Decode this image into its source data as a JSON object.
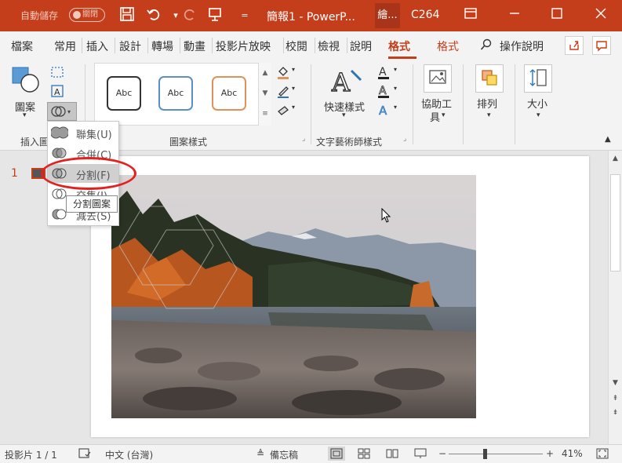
{
  "colors": {
    "accent": "#c43e1c",
    "highlight_oval": "#e32121"
  },
  "titlebar": {
    "autosave_label": "自動儲存",
    "autosave_state": "關閉",
    "doc_title": "簡報1 - PowerP...",
    "user_short": "繪...",
    "user_name": "C264",
    "icons": [
      "save-icon",
      "undo-icon",
      "redo-icon",
      "presentation-icon",
      "customize-icon",
      "ribbon-display-icon",
      "minimize-icon",
      "maximize-icon",
      "close-icon"
    ]
  },
  "tabs": {
    "items": [
      "檔案",
      "常用",
      "插入",
      "設計",
      "轉場",
      "動畫",
      "投影片放映",
      "校閱",
      "檢視",
      "說明",
      "格式",
      "格式"
    ],
    "active": "格式",
    "search": "操作說明"
  },
  "ribbon": {
    "insert_shapes": {
      "shape_label": "圖案",
      "group_label": "插入圖"
    },
    "shape_styles": {
      "group_label": "圖案樣式",
      "styles": [
        {
          "label": "Abc",
          "color": "#333333"
        },
        {
          "label": "Abc",
          "color": "#5b8fc7"
        },
        {
          "label": "Abc",
          "color": "#e0925c"
        }
      ]
    },
    "wordart": {
      "quick_styles_label": "快速樣式",
      "group_label": "文字藝術師樣式"
    },
    "accessibility": {
      "label_line1": "協助工",
      "label_line2": "具"
    },
    "arrange": {
      "label": "排列"
    },
    "size": {
      "label": "大小"
    }
  },
  "merge_menu": {
    "items": [
      {
        "label": "聯集(U)"
      },
      {
        "label": "合併(C)"
      },
      {
        "label": "分割(F)"
      },
      {
        "label": "交集(I)"
      },
      {
        "label": "減去(S)"
      }
    ],
    "hovered_index": 2,
    "tooltip": "分割圖案"
  },
  "slides": {
    "current_number": "1"
  },
  "statusbar": {
    "slide_info": "投影片 1 / 1",
    "language": "中文 (台灣)",
    "notes": "備忘稿",
    "zoom_minus": "−",
    "zoom_plus": "+",
    "zoom": "41%",
    "zoom_level": 0.41
  }
}
